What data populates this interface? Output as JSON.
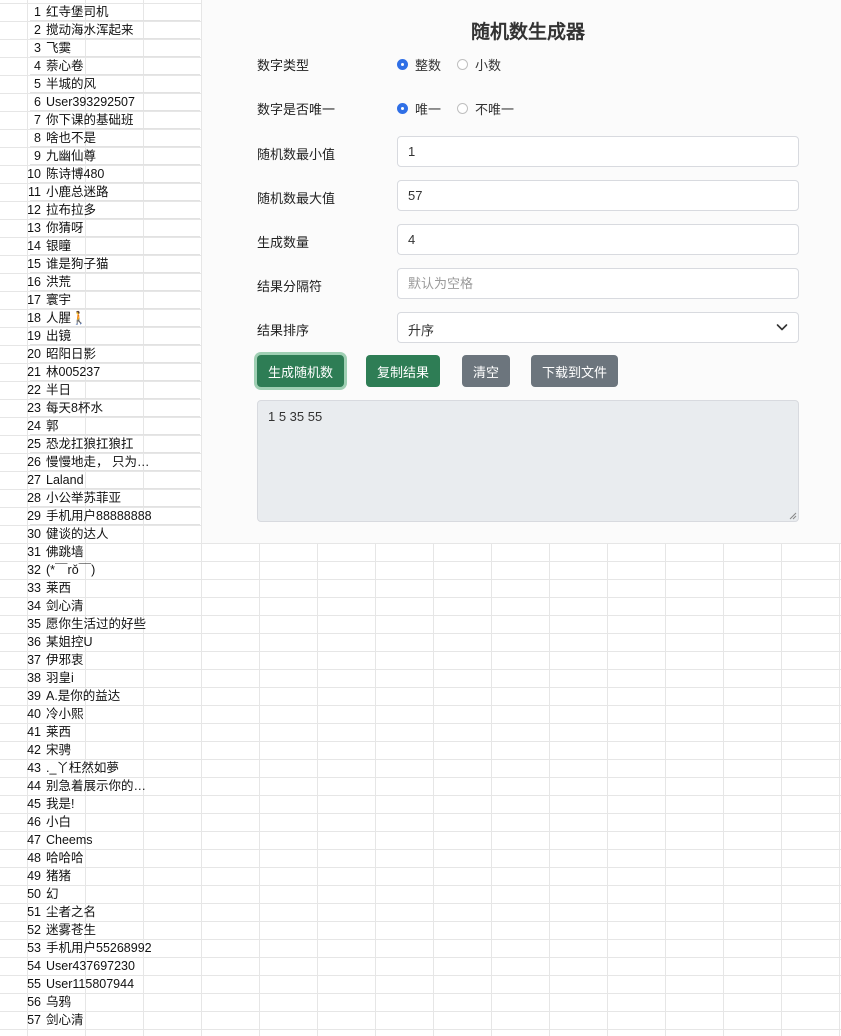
{
  "names": [
    "红寺堡司机",
    "搅动海水浑起来",
    "飞霙",
    "萘心卷",
    "半城的风",
    "User393292507",
    "你下课的基础班",
    "啥也不是",
    "九幽仙尊",
    "陈诗博480",
    "小鹿总迷路",
    "拉布拉多",
    "你猜呀",
    "银瞳",
    "谁是狗子猫",
    "洪荒",
    "寰宇",
    "人腥🚶",
    "出镜",
    "昭阳日影",
    "林005237",
    "半日",
    "每天8杯水",
    "郭",
    "恐龙扛狼扛狼扛",
    "慢慢地走， 只为等...",
    "Laland",
    "小公举苏菲亚",
    "手机用户88888888",
    "健谈的达人",
    "佛跳墙",
    "(*￣rǒ￣)",
    "莱西",
    "剑心清",
    "愿你生活过的好些",
    "某姐控U",
    "伊邪衷",
    "羽皇i",
    "A.是你的益达",
    "冷小熙",
    "莱西",
    "宋骋",
    "._丫枉然如夢",
    "别急着展示你的愚蠢",
    "我是!",
    "小白",
    "Cheems",
    "哈哈哈",
    "猪猪",
    "幻",
    "尘者之名",
    "迷雾苍生",
    "手机用户55268992",
    "User437697230",
    "User115807944",
    "乌鸦",
    "剑心清"
  ],
  "panel": {
    "title": "随机数生成器",
    "number_type": {
      "label": "数字类型",
      "options": [
        "整数",
        "小数"
      ],
      "selected": "整数"
    },
    "unique": {
      "label": "数字是否唯一",
      "options": [
        "唯一",
        "不唯一"
      ],
      "selected": "唯一"
    },
    "min": {
      "label": "随机数最小值",
      "value": "1"
    },
    "max": {
      "label": "随机数最大值",
      "value": "57"
    },
    "count": {
      "label": "生成数量",
      "value": "4"
    },
    "separator": {
      "label": "结果分隔符",
      "value": "",
      "placeholder": "默认为空格"
    },
    "sort": {
      "label": "结果排序",
      "value": "升序"
    },
    "buttons": {
      "generate": "生成随机数",
      "copy": "复制结果",
      "clear": "清空",
      "download": "下载到文件"
    },
    "result": "1 5 35 55",
    "colors": {
      "primary_green": "#2e7d55",
      "secondary_gray": "#6c757d",
      "radio_blue": "#2f6fe6"
    }
  }
}
